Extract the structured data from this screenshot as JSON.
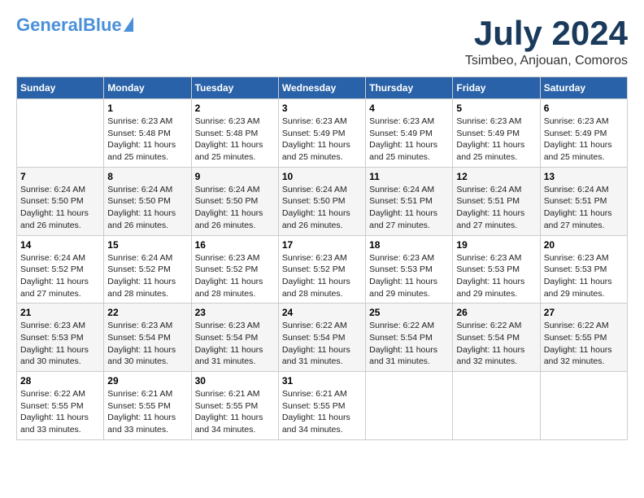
{
  "header": {
    "logo_general": "General",
    "logo_blue": "Blue",
    "title": "July 2024",
    "subtitle": "Tsimbeo, Anjouan, Comoros"
  },
  "days_of_week": [
    "Sunday",
    "Monday",
    "Tuesday",
    "Wednesday",
    "Thursday",
    "Friday",
    "Saturday"
  ],
  "weeks": [
    [
      {
        "num": "",
        "info": ""
      },
      {
        "num": "1",
        "info": "Sunrise: 6:23 AM\nSunset: 5:48 PM\nDaylight: 11 hours\nand 25 minutes."
      },
      {
        "num": "2",
        "info": "Sunrise: 6:23 AM\nSunset: 5:48 PM\nDaylight: 11 hours\nand 25 minutes."
      },
      {
        "num": "3",
        "info": "Sunrise: 6:23 AM\nSunset: 5:49 PM\nDaylight: 11 hours\nand 25 minutes."
      },
      {
        "num": "4",
        "info": "Sunrise: 6:23 AM\nSunset: 5:49 PM\nDaylight: 11 hours\nand 25 minutes."
      },
      {
        "num": "5",
        "info": "Sunrise: 6:23 AM\nSunset: 5:49 PM\nDaylight: 11 hours\nand 25 minutes."
      },
      {
        "num": "6",
        "info": "Sunrise: 6:23 AM\nSunset: 5:49 PM\nDaylight: 11 hours\nand 25 minutes."
      }
    ],
    [
      {
        "num": "7",
        "info": "Sunrise: 6:24 AM\nSunset: 5:50 PM\nDaylight: 11 hours\nand 26 minutes."
      },
      {
        "num": "8",
        "info": "Sunrise: 6:24 AM\nSunset: 5:50 PM\nDaylight: 11 hours\nand 26 minutes."
      },
      {
        "num": "9",
        "info": "Sunrise: 6:24 AM\nSunset: 5:50 PM\nDaylight: 11 hours\nand 26 minutes."
      },
      {
        "num": "10",
        "info": "Sunrise: 6:24 AM\nSunset: 5:50 PM\nDaylight: 11 hours\nand 26 minutes."
      },
      {
        "num": "11",
        "info": "Sunrise: 6:24 AM\nSunset: 5:51 PM\nDaylight: 11 hours\nand 27 minutes."
      },
      {
        "num": "12",
        "info": "Sunrise: 6:24 AM\nSunset: 5:51 PM\nDaylight: 11 hours\nand 27 minutes."
      },
      {
        "num": "13",
        "info": "Sunrise: 6:24 AM\nSunset: 5:51 PM\nDaylight: 11 hours\nand 27 minutes."
      }
    ],
    [
      {
        "num": "14",
        "info": "Sunrise: 6:24 AM\nSunset: 5:52 PM\nDaylight: 11 hours\nand 27 minutes."
      },
      {
        "num": "15",
        "info": "Sunrise: 6:24 AM\nSunset: 5:52 PM\nDaylight: 11 hours\nand 28 minutes."
      },
      {
        "num": "16",
        "info": "Sunrise: 6:23 AM\nSunset: 5:52 PM\nDaylight: 11 hours\nand 28 minutes."
      },
      {
        "num": "17",
        "info": "Sunrise: 6:23 AM\nSunset: 5:52 PM\nDaylight: 11 hours\nand 28 minutes."
      },
      {
        "num": "18",
        "info": "Sunrise: 6:23 AM\nSunset: 5:53 PM\nDaylight: 11 hours\nand 29 minutes."
      },
      {
        "num": "19",
        "info": "Sunrise: 6:23 AM\nSunset: 5:53 PM\nDaylight: 11 hours\nand 29 minutes."
      },
      {
        "num": "20",
        "info": "Sunrise: 6:23 AM\nSunset: 5:53 PM\nDaylight: 11 hours\nand 29 minutes."
      }
    ],
    [
      {
        "num": "21",
        "info": "Sunrise: 6:23 AM\nSunset: 5:53 PM\nDaylight: 11 hours\nand 30 minutes."
      },
      {
        "num": "22",
        "info": "Sunrise: 6:23 AM\nSunset: 5:54 PM\nDaylight: 11 hours\nand 30 minutes."
      },
      {
        "num": "23",
        "info": "Sunrise: 6:23 AM\nSunset: 5:54 PM\nDaylight: 11 hours\nand 31 minutes."
      },
      {
        "num": "24",
        "info": "Sunrise: 6:22 AM\nSunset: 5:54 PM\nDaylight: 11 hours\nand 31 minutes."
      },
      {
        "num": "25",
        "info": "Sunrise: 6:22 AM\nSunset: 5:54 PM\nDaylight: 11 hours\nand 31 minutes."
      },
      {
        "num": "26",
        "info": "Sunrise: 6:22 AM\nSunset: 5:54 PM\nDaylight: 11 hours\nand 32 minutes."
      },
      {
        "num": "27",
        "info": "Sunrise: 6:22 AM\nSunset: 5:55 PM\nDaylight: 11 hours\nand 32 minutes."
      }
    ],
    [
      {
        "num": "28",
        "info": "Sunrise: 6:22 AM\nSunset: 5:55 PM\nDaylight: 11 hours\nand 33 minutes."
      },
      {
        "num": "29",
        "info": "Sunrise: 6:21 AM\nSunset: 5:55 PM\nDaylight: 11 hours\nand 33 minutes."
      },
      {
        "num": "30",
        "info": "Sunrise: 6:21 AM\nSunset: 5:55 PM\nDaylight: 11 hours\nand 34 minutes."
      },
      {
        "num": "31",
        "info": "Sunrise: 6:21 AM\nSunset: 5:55 PM\nDaylight: 11 hours\nand 34 minutes."
      },
      {
        "num": "",
        "info": ""
      },
      {
        "num": "",
        "info": ""
      },
      {
        "num": "",
        "info": ""
      }
    ]
  ]
}
